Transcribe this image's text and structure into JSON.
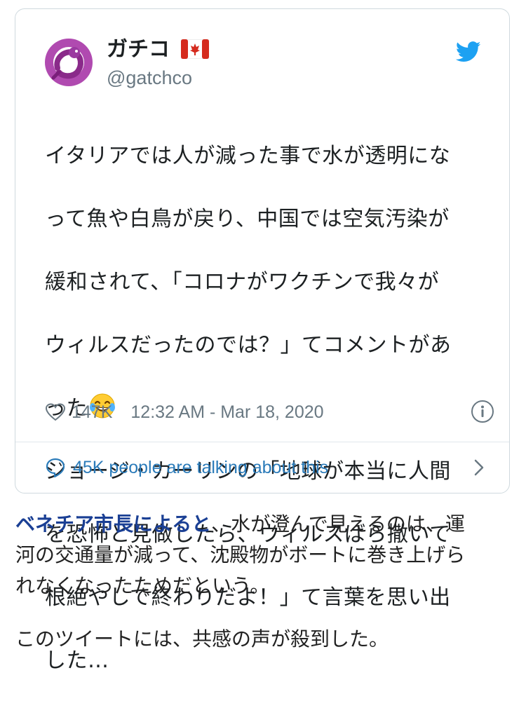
{
  "tweet": {
    "display_name": "ガチコ",
    "handle": "@gatchco",
    "text_lines": [
      "イタリアでは人が減った事で水が透明にな",
      "って魚や白鳥が戻り、中国では空気汚染が",
      "緩和されて、「コロナがワクチンで我々が",
      "ウィルスだったのでは？」てコメントがあ",
      "った",
      "ジョージ・カーリンの「地球が本当に人間",
      "を恐怖と見做したら、ウィルスばら撒いて",
      "根絶やしで終わりだよ！」て言葉を思い出",
      "した…"
    ],
    "likes": "147K",
    "timestamp": "12:32 AM - Mar 18, 2020",
    "talking": "45K people are talking about this",
    "icons": {
      "avatar": "purple-dragon-avatar",
      "flag": "canada-flag-icon",
      "bird": "twitter-bird-icon",
      "emoji": "tears-of-joy-emoji",
      "heart": "heart-icon",
      "info": "info-icon",
      "bubble": "speech-bubble-icon",
      "chevron": "chevron-right-icon"
    }
  },
  "article": {
    "link_text": "ベネチア市長によると",
    "para1_line1_rest": "、水が澄んで見えるのは、運",
    "para1_line2": "河の交通量が減って、沈殿物がボートに巻き上げら",
    "para1_line3": "れなくなったためだという。",
    "para2": "このツイートには、共感の声が殺到した。"
  },
  "colors": {
    "twitter_blue": "#1da1f2",
    "link_blue": "#1a3f94",
    "muted": "#697882",
    "talk_blue": "#2b7bb9"
  }
}
